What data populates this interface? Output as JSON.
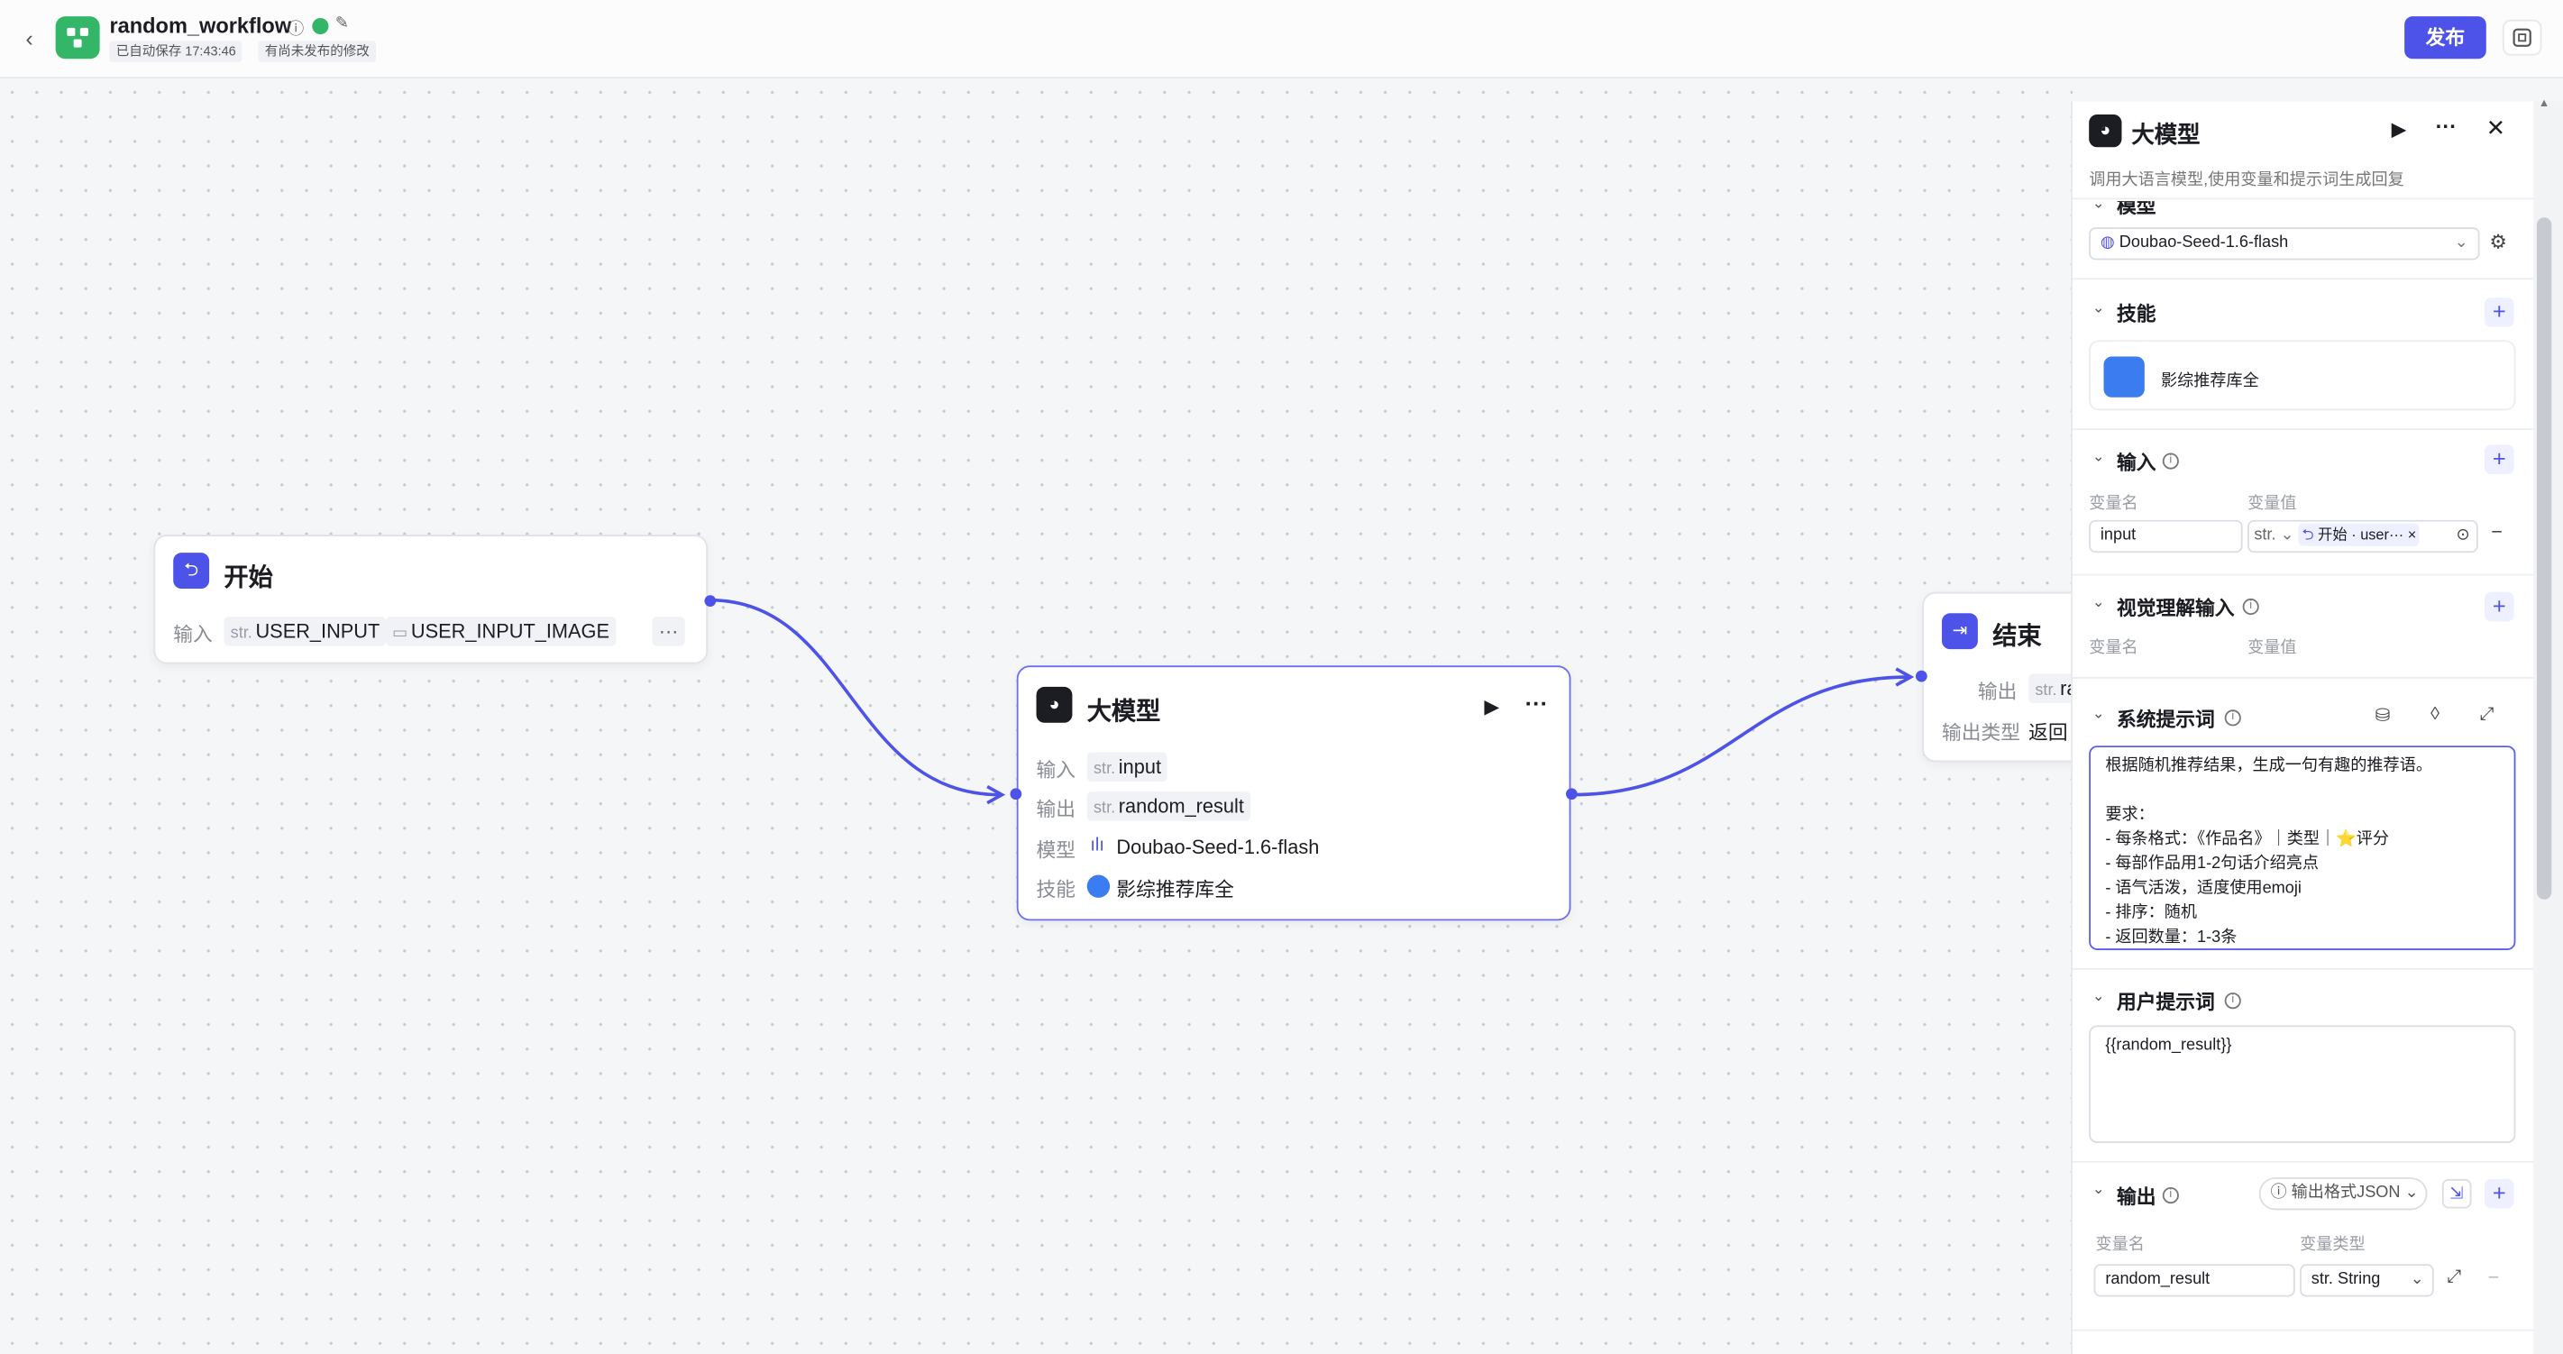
{
  "topbar": {
    "back_icon": "chevron-left-icon",
    "app_title": "random_workflow",
    "autosave": "已自动保存 17:43:46",
    "unpublished": "有尚未发布的修改",
    "publish_label": "发布"
  },
  "nodes": {
    "start": {
      "title": "开始",
      "input_label": "输入",
      "input_chip1_type": "str.",
      "input_chip1": "USER_INPUT",
      "input_chip2": "USER_INPUT_IMAGE",
      "more": "···"
    },
    "llm": {
      "title": "大模型",
      "input_label": "输入",
      "input_type": "str.",
      "input_value": "input",
      "output_label": "输出",
      "output_type": "str.",
      "output_value": "random_result",
      "model_label": "模型",
      "model_value": "Doubao-Seed-1.6-flash",
      "skill_label": "技能",
      "skill_value": "影综推荐库全",
      "more": "···"
    },
    "end": {
      "title": "结束",
      "output_label": "输出",
      "output_type": "str.",
      "output_value": "ra",
      "output_type_label": "输出类型",
      "output_type_value": "返回"
    }
  },
  "panel": {
    "title": "大模型",
    "description": "调用大语言模型,使用变量和提示词生成回复",
    "model_section": "模型",
    "model_value": "Doubao-Seed-1.6-flash",
    "skills_section": "技能",
    "skill_item": "影综推荐库全",
    "input_section": "输入",
    "var_name_label": "变量名",
    "var_value_label": "变量值",
    "input_var_name": "input",
    "input_var_type": "str.",
    "input_ref_label": "开始 · user···",
    "visual_section": "视觉理解输入",
    "visual_var_name_label": "变量名",
    "visual_var_value_label": "变量值",
    "system_prompt_section": "系统提示词",
    "system_prompt_lines": [
      "根据随机推荐结果，生成一句有趣的推荐语。",
      "",
      "要求：",
      "- 每条格式：《作品名》｜类型｜⭐评分",
      "- 每部作品用1-2句话介绍亮点",
      "- 语气活泼，适度使用emoji",
      "- 排序：随机",
      "- 返回数量：1-3条"
    ],
    "user_prompt_section": "用户提示词",
    "user_prompt_value": "{{random_result}}",
    "output_section": "输出",
    "output_format": "输出格式JSON",
    "out_var_name_label": "变量名",
    "out_var_type_label": "变量类型",
    "output_var_name": "random_result",
    "output_var_type": "str. String"
  },
  "colors": {
    "accent": "#4d53e8",
    "success": "#33b667"
  }
}
